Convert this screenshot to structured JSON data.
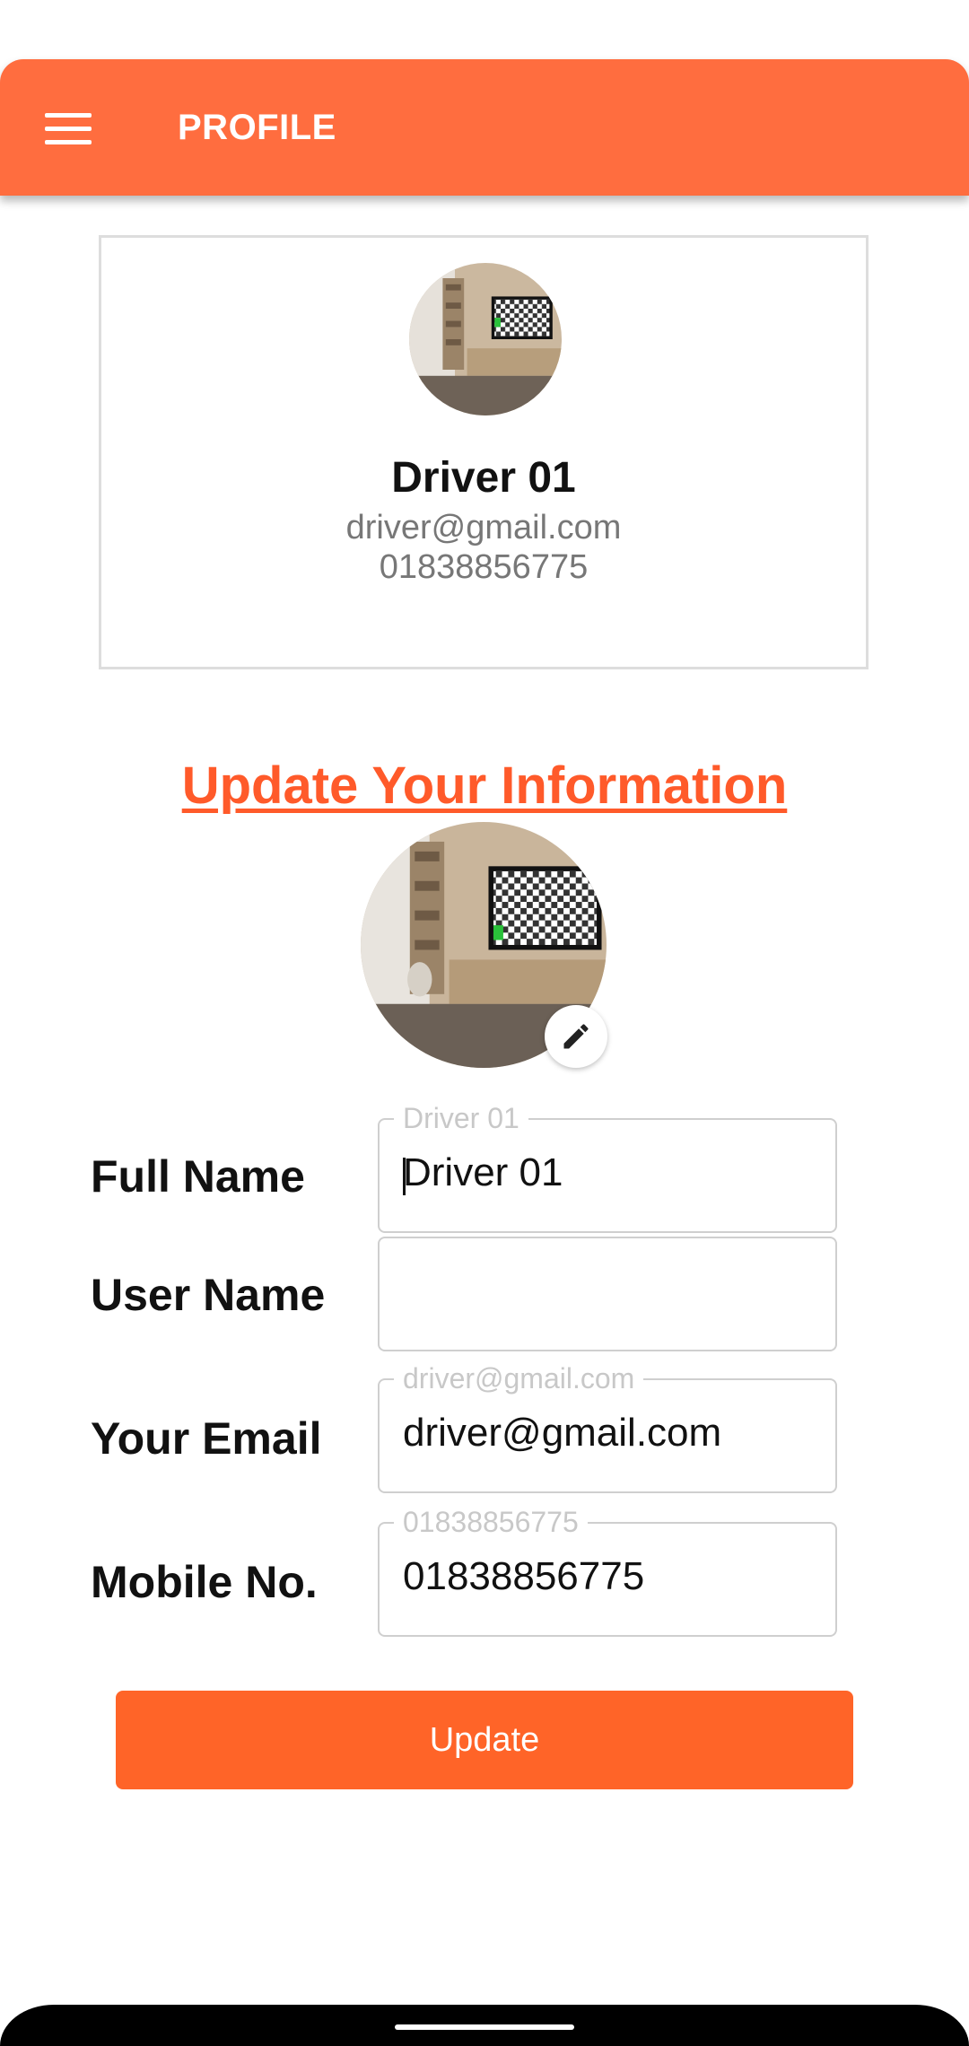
{
  "appbar": {
    "title": "PROFILE",
    "menu_icon": "hamburger-menu-icon"
  },
  "profile_card": {
    "name": "Driver 01",
    "email": "driver@gmail.com",
    "phone": "01838856775"
  },
  "update_section": {
    "title": "Update Your Information",
    "edit_icon": "pencil-icon"
  },
  "form": {
    "full_name": {
      "label": "Full Name",
      "legend": "Driver 01",
      "value": "Driver 01"
    },
    "user_name": {
      "label": "User Name",
      "legend": "",
      "value": ""
    },
    "email": {
      "label": "Your Email",
      "legend": "driver@gmail.com",
      "value": "driver@gmail.com"
    },
    "mobile": {
      "label": "Mobile No.",
      "legend": "01838856775",
      "value": "01838856775"
    }
  },
  "update_button": {
    "label": "Update"
  },
  "colors": {
    "accent": "#FF6D3F",
    "button": "#FF6428",
    "title": "#FF5A2A"
  }
}
